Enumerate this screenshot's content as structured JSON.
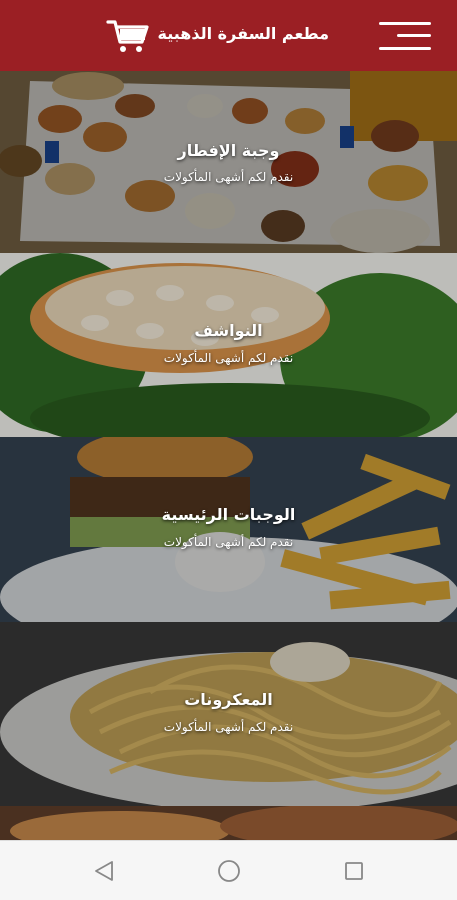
{
  "header": {
    "title": "مطعم السفرة الذهبية",
    "menu_icon": "hamburger-menu-icon",
    "cart_icon": "shopping-cart-icon",
    "bg_color": "#9b1f24"
  },
  "categories": [
    {
      "title": "وجبة الإفطار",
      "subtitle": "نقدم لكم أشهى المأكولات"
    },
    {
      "title": "النواشف",
      "subtitle": "نقدم لكم أشهى المأكولات"
    },
    {
      "title": "الوجبات الرئيسية",
      "subtitle": "نقدم لكم أشهى المأكولات"
    },
    {
      "title": "المعكرونات",
      "subtitle": "نقدم لكم أشهى المأكولات"
    }
  ],
  "system_nav": {
    "back_icon": "back-triangle-icon",
    "home_icon": "home-circle-icon",
    "recents_icon": "recents-square-icon"
  }
}
